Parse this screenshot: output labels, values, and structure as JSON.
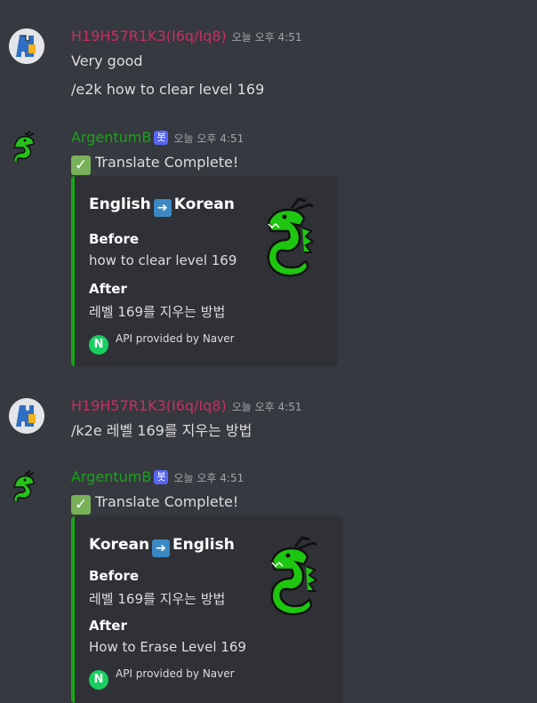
{
  "messages": [
    {
      "author": "H19H57R1K3(I6q/Iq8)",
      "timestamp": "오늘 오후 4:51",
      "lines": [
        "Very good",
        "/e2k how to clear level 169"
      ]
    },
    {
      "author": "ArgentumB",
      "bot_tag": "봇",
      "timestamp": "오늘 오후 4:51",
      "text": "Translate Complete!",
      "embed": {
        "title_from": "English",
        "title_to": "Korean",
        "before_label": "Before",
        "before_value": "how to clear level 169",
        "after_label": "After",
        "after_value": "레벨 169를 지우는 방법",
        "footer": "API provided by Naver",
        "footer_icon_letter": "N"
      }
    },
    {
      "author": "H19H57R1K3(I6q/Iq8)",
      "timestamp": "오늘 오후 4:51",
      "lines": [
        "/k2e 레벨 169를 지우는 방법"
      ]
    },
    {
      "author": "ArgentumB",
      "bot_tag": "봇",
      "timestamp": "오늘 오후 4:51",
      "text": "Translate Complete!",
      "embed": {
        "title_from": "Korean",
        "title_to": "English",
        "before_label": "Before",
        "before_value": "레벨 169를 지우는 방법",
        "after_label": "After",
        "after_value": "How to Erase Level 169",
        "footer": "API provided by Naver",
        "footer_icon_letter": "N"
      }
    }
  ],
  "colors": {
    "background": "#36393f",
    "user_name": "#c92d63",
    "bot_name": "#1aa31a",
    "embed_bg": "#2f3136",
    "embed_accent": "#1aa31a",
    "bot_tag": "#5865f2"
  },
  "icons": {
    "user_avatar": "puzzle-avatar-icon",
    "bot_avatar": "green-dragon-icon",
    "check": "check-mark-icon",
    "arrow": "right-arrow-icon",
    "naver": "naver-logo-icon"
  }
}
